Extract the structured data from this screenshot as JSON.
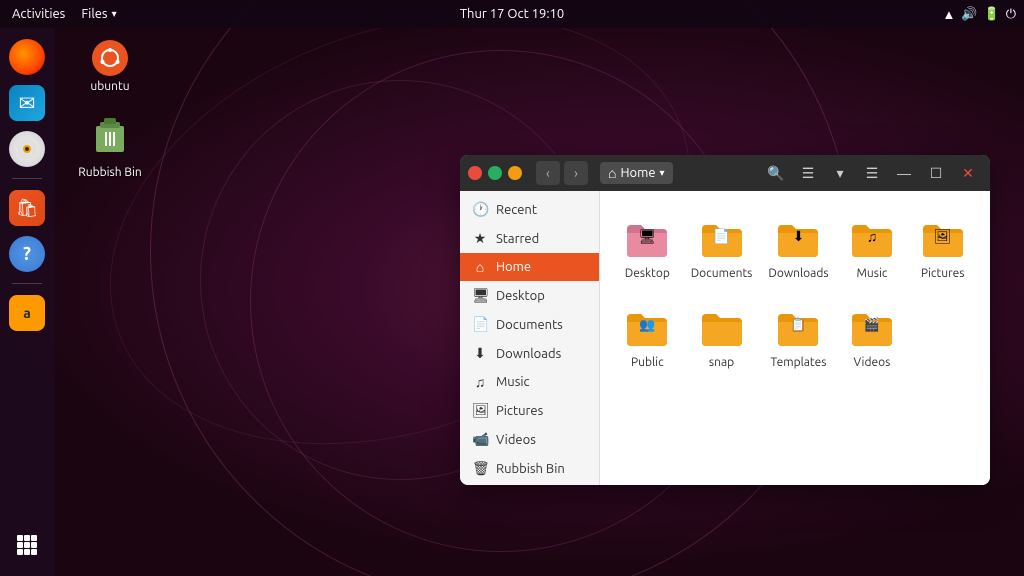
{
  "topbar": {
    "activities": "Activities",
    "files_menu": "Files",
    "datetime": "Thur 17 Oct 19:10",
    "dropdown_arrow": "▾"
  },
  "dock": {
    "items": [
      {
        "name": "firefox",
        "label": "Firefox"
      },
      {
        "name": "thunderbird",
        "label": "Thunderbird"
      },
      {
        "name": "rhythmbox",
        "label": "Rhythmbox"
      },
      {
        "name": "software-center",
        "label": "Software Center"
      },
      {
        "name": "help",
        "label": "Help"
      },
      {
        "name": "amazon",
        "label": "Amazon"
      },
      {
        "name": "show-apps",
        "label": "Show Applications"
      }
    ]
  },
  "desktop": {
    "icons": [
      {
        "name": "ubuntu",
        "label": "ubuntu"
      },
      {
        "name": "rubbish-bin",
        "label": "Rubbish Bin"
      }
    ]
  },
  "file_manager": {
    "title": "Home",
    "nav": {
      "back": "‹",
      "forward": "›",
      "home_icon": "⌂",
      "location": "Home",
      "dropdown": "▾"
    },
    "actions": {
      "search": "🔍",
      "list_view": "≡",
      "view_options": "▾",
      "menu": "☰",
      "minimize": "—",
      "restore": "☐",
      "close": "✕"
    },
    "sidebar": {
      "items": [
        {
          "id": "recent",
          "icon": "🕐",
          "label": "Recent",
          "active": false
        },
        {
          "id": "starred",
          "icon": "★",
          "label": "Starred",
          "active": false
        },
        {
          "id": "home",
          "icon": "⌂",
          "label": "Home",
          "active": true
        },
        {
          "id": "desktop",
          "icon": "🖥",
          "label": "Desktop",
          "active": false
        },
        {
          "id": "documents",
          "icon": "📄",
          "label": "Documents",
          "active": false
        },
        {
          "id": "downloads",
          "icon": "⬇",
          "label": "Downloads",
          "active": false
        },
        {
          "id": "music",
          "icon": "♫",
          "label": "Music",
          "active": false
        },
        {
          "id": "pictures",
          "icon": "🖼",
          "label": "Pictures",
          "active": false
        },
        {
          "id": "videos",
          "icon": "📹",
          "label": "Videos",
          "active": false
        },
        {
          "id": "rubbish-bin",
          "icon": "🗑",
          "label": "Rubbish Bin",
          "active": false
        }
      ]
    },
    "folders": [
      {
        "id": "desktop",
        "label": "Desktop",
        "overlay": "🖥",
        "color": "pink"
      },
      {
        "id": "documents",
        "label": "Documents",
        "overlay": "📄",
        "color": "orange"
      },
      {
        "id": "downloads",
        "label": "Downloads",
        "overlay": "⬇",
        "color": "orange"
      },
      {
        "id": "music",
        "label": "Music",
        "overlay": "♫",
        "color": "orange"
      },
      {
        "id": "pictures",
        "label": "Pictures",
        "overlay": "🖼",
        "color": "orange"
      },
      {
        "id": "public",
        "label": "Public",
        "overlay": "👥",
        "color": "orange"
      },
      {
        "id": "snap",
        "label": "snap",
        "overlay": "",
        "color": "orange"
      },
      {
        "id": "templates",
        "label": "Templates",
        "overlay": "📋",
        "color": "orange"
      },
      {
        "id": "videos",
        "label": "Videos",
        "overlay": "🎬",
        "color": "orange"
      }
    ]
  }
}
